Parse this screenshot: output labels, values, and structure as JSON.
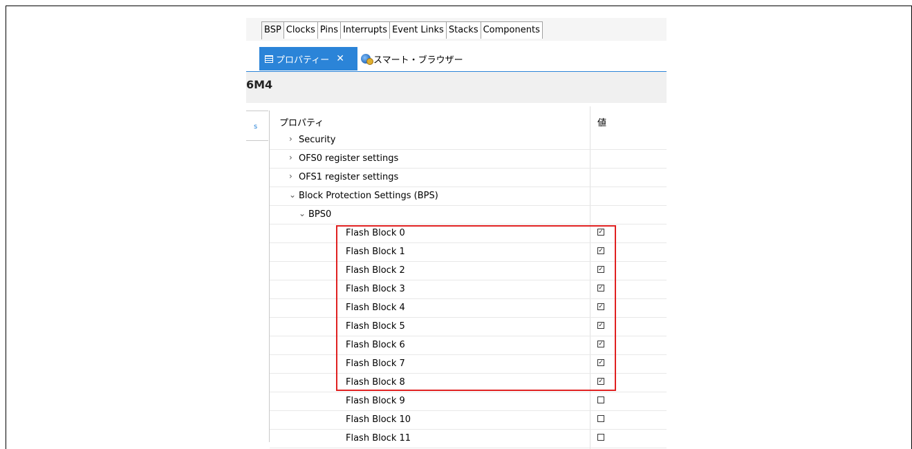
{
  "config_tabs": [
    "BSP",
    "Clocks",
    "Pins",
    "Interrupts",
    "Event Links",
    "Stacks",
    "Components"
  ],
  "view_tabs": {
    "active_label": "プロパティー",
    "active_close": "✕",
    "second_label": "スマート・ブラウザー"
  },
  "panel_title": "6M4",
  "side_tab_mark": "s",
  "table": {
    "col_property": "プロパティ",
    "col_value": "値",
    "rows": [
      {
        "label": "Security",
        "chevron": "›",
        "level": 1,
        "checked": null
      },
      {
        "label": "OFS0 register settings",
        "chevron": "›",
        "level": 1,
        "checked": null
      },
      {
        "label": "OFS1 register settings",
        "chevron": "›",
        "level": 1,
        "checked": null
      },
      {
        "label": "Block Protection Settings (BPS)",
        "chevron": "⌄",
        "level": 1,
        "checked": null
      },
      {
        "label": "BPS0",
        "chevron": "⌄",
        "level": 2,
        "checked": null
      },
      {
        "label": "Flash Block 0",
        "chevron": "",
        "level": 3,
        "checked": true
      },
      {
        "label": "Flash Block 1",
        "chevron": "",
        "level": 3,
        "checked": true
      },
      {
        "label": "Flash Block 2",
        "chevron": "",
        "level": 3,
        "checked": true
      },
      {
        "label": "Flash Block 3",
        "chevron": "",
        "level": 3,
        "checked": true
      },
      {
        "label": "Flash Block 4",
        "chevron": "",
        "level": 3,
        "checked": true
      },
      {
        "label": "Flash Block 5",
        "chevron": "",
        "level": 3,
        "checked": true
      },
      {
        "label": "Flash Block 6",
        "chevron": "",
        "level": 3,
        "checked": true
      },
      {
        "label": "Flash Block 7",
        "chevron": "",
        "level": 3,
        "checked": true
      },
      {
        "label": "Flash Block 8",
        "chevron": "",
        "level": 3,
        "checked": true
      },
      {
        "label": "Flash Block 9",
        "chevron": "",
        "level": 3,
        "checked": false
      },
      {
        "label": "Flash Block 10",
        "chevron": "",
        "level": 3,
        "checked": false
      },
      {
        "label": "Flash Block 11",
        "chevron": "",
        "level": 3,
        "checked": false
      }
    ]
  },
  "colors": {
    "accent": "#2b84d8",
    "highlight": "#e02020"
  }
}
